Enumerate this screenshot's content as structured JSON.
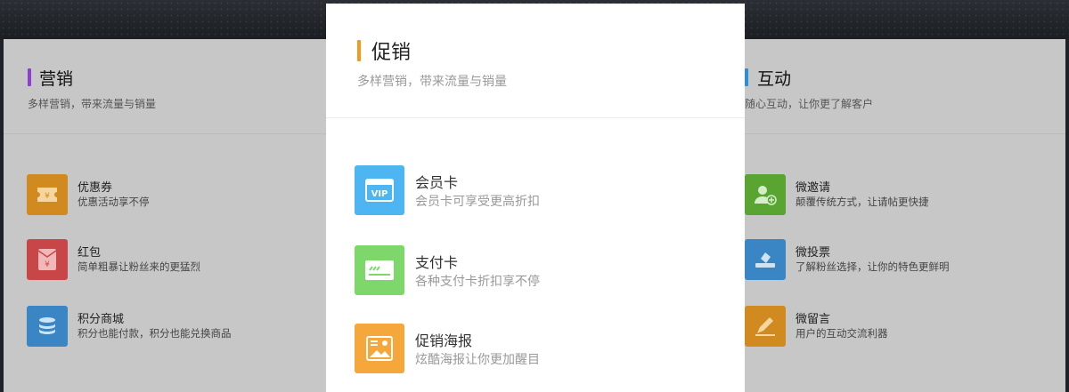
{
  "left_panel": {
    "title": "营销",
    "subtitle": "多样营销，带来流量与销量",
    "accent": "#8e3fd1",
    "items": [
      {
        "title": "优惠券",
        "desc": "优惠活动享不停",
        "icon": "ticket-icon",
        "color": "#d08a1f"
      },
      {
        "title": "红包",
        "desc": "简单粗暴让粉丝来的更猛烈",
        "icon": "red-envelope-icon",
        "color": "#c94648"
      },
      {
        "title": "积分商城",
        "desc": "积分也能付款，积分也能兑换商品",
        "icon": "coins-icon",
        "color": "#3a86c4"
      }
    ]
  },
  "right_panel": {
    "title": "互动",
    "subtitle": "随心互动，让你更了解客户",
    "accent": "#2f8fd4",
    "items": [
      {
        "title": "微邀请",
        "desc": "颠覆传统方式，让请帖更快捷",
        "icon": "add-user-icon",
        "color": "#5aa532"
      },
      {
        "title": "微投票",
        "desc": "了解粉丝选择，让你的特色更鲜明",
        "icon": "vote-icon",
        "color": "#3a86c4"
      },
      {
        "title": "微留言",
        "desc": "用户的互动交流利器",
        "icon": "edit-icon",
        "color": "#d08a1f"
      }
    ]
  },
  "modal": {
    "title": "促销",
    "subtitle": "多样营销，带来流量与销量",
    "accent": "#f39a1c",
    "items": [
      {
        "title": "会员卡",
        "desc": "会员卡可享受更高折扣",
        "icon": "vip-card-icon",
        "color": "#4db6f2"
      },
      {
        "title": "支付卡",
        "desc": "各种支付卡折扣享不停",
        "icon": "payment-card-icon",
        "color": "#7ed76a"
      },
      {
        "title": "促销海报",
        "desc": "炫酷海报让你更加醒目",
        "icon": "poster-icon",
        "color": "#f6a73b"
      }
    ]
  }
}
